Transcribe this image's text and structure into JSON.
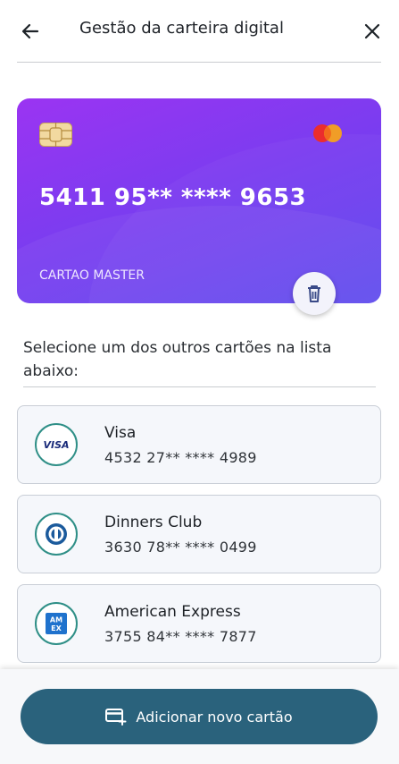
{
  "header": {
    "title": "Gestão da carteira digital",
    "back_icon": "arrow-left-icon",
    "close_icon": "close-icon"
  },
  "card": {
    "number": "5411 95** **** 9653",
    "holder_label": "CARTAO MASTER",
    "brand": "Mastercard",
    "colors": {
      "gradient_start": "#9b34f2",
      "gradient_end": "#5b47ee"
    }
  },
  "instruction": "Selecione um dos outros cartões na lista abaixo:",
  "other_cards": [
    {
      "name": "Visa",
      "number": "4532 27** **** 4989",
      "logo_text": "VISA",
      "icon": "visa-logo-icon"
    },
    {
      "name": "Dinners Club",
      "number": "3630 78** **** 0499",
      "icon": "diners-club-logo-icon"
    },
    {
      "name": "American Express",
      "number": "3755 84** **** 7877",
      "logo_text": "AM EX",
      "icon": "amex-logo-icon"
    }
  ],
  "footer": {
    "add_button_label": "Adicionar novo cartão",
    "add_icon": "add-card-icon",
    "button_color": "#2a627c"
  },
  "colors": {
    "accent": "#2a627c",
    "brand_ring": "#2f8f87"
  }
}
